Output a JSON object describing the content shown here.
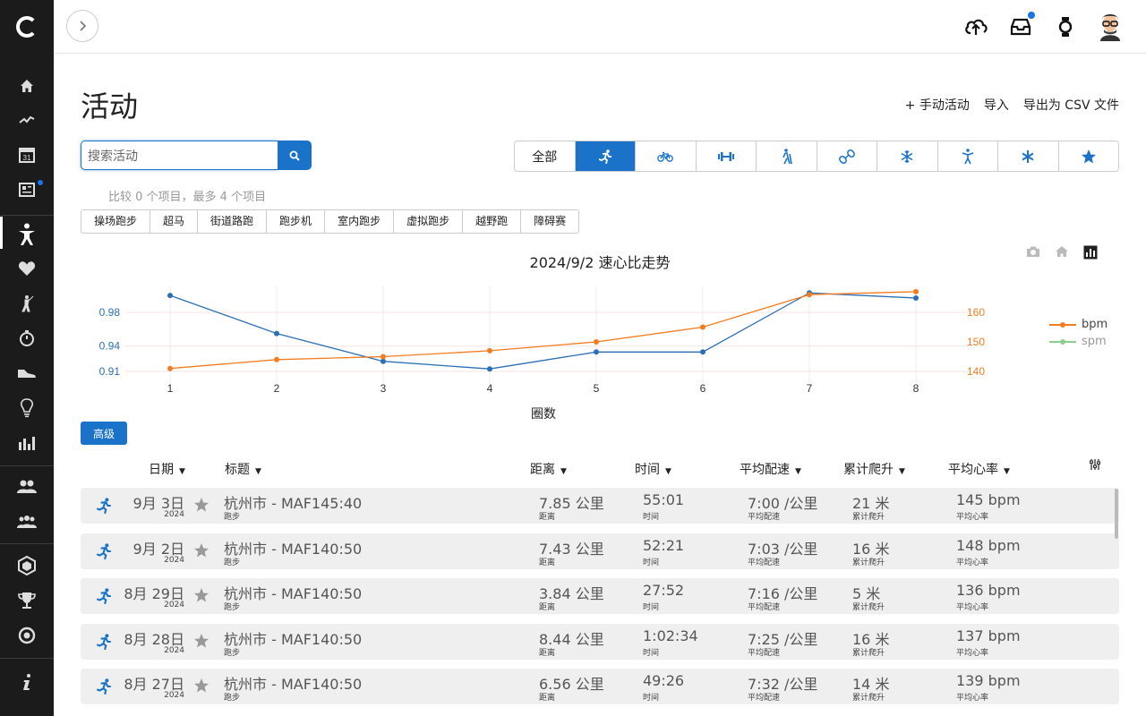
{
  "page": {
    "title": "活动",
    "actions": [
      "+ 手动活动",
      "导入",
      "导出为 CSV 文件"
    ]
  },
  "search": {
    "placeholder": "搜索活动"
  },
  "compare_text": "比较 0 个项目，最多 4 个项目",
  "type_filters": [
    {
      "label": "全部",
      "icon": "",
      "active": false
    },
    {
      "label": "",
      "icon": "running-icon",
      "active": true
    },
    {
      "label": "",
      "icon": "cycling-icon",
      "active": false
    },
    {
      "label": "",
      "icon": "strength-icon",
      "active": false
    },
    {
      "label": "",
      "icon": "hiking-icon",
      "active": false
    },
    {
      "label": "",
      "icon": "multisport-icon",
      "active": false
    },
    {
      "label": "",
      "icon": "winter-sports-icon",
      "active": false
    },
    {
      "label": "",
      "icon": "fitness-icon",
      "active": false
    },
    {
      "label": "",
      "icon": "other-icon",
      "active": false
    },
    {
      "label": "",
      "icon": "favorites-icon",
      "active": false
    }
  ],
  "subtypes": [
    "操场跑步",
    "超马",
    "街道路跑",
    "跑步机",
    "室内跑步",
    "虚拟跑步",
    "越野跑",
    "障碍赛"
  ],
  "chart_data": {
    "type": "line",
    "title": "2024/9/2 速心比走势",
    "xlabel": "圈数",
    "x": [
      1,
      2,
      3,
      4,
      5,
      6,
      7,
      8
    ],
    "y_left_ticks": [
      "0.91",
      "0.94",
      "0.98"
    ],
    "y_right_ticks": [
      "140",
      "150",
      "160"
    ],
    "series": [
      {
        "name": "",
        "axis": "left",
        "color": "#2b6fb5",
        "values": [
          1.0,
          0.955,
          0.922,
          0.913,
          0.933,
          0.933,
          1.003,
          0.997
        ]
      },
      {
        "name": "bpm",
        "axis": "right",
        "color": "#f47c20",
        "values": [
          141,
          144,
          145,
          147,
          150,
          155,
          166,
          167
        ]
      },
      {
        "name": "spm",
        "axis": "right",
        "color": "#8ccf8c",
        "values": []
      }
    ],
    "legend_placement": "right",
    "grid": true
  },
  "advanced_button": "高级",
  "table": {
    "headers": [
      "日期",
      "标题",
      "距离",
      "时间",
      "平均配速",
      "累计爬升",
      "平均心率"
    ],
    "sub_labels": {
      "distance": "距离",
      "time": "时间",
      "pace": "平均配速",
      "ascent": "累计爬升",
      "hr": "平均心率"
    },
    "rows": [
      {
        "date": "9月 3日",
        "year": "2024",
        "title": "杭州市 - MAF145:40",
        "type": "跑步",
        "distance": "7.85 公里",
        "time": "55:01",
        "pace": "7:00 /公里",
        "ascent": "21 米",
        "hr": "145 bpm"
      },
      {
        "date": "9月 2日",
        "year": "2024",
        "title": "杭州市 - MAF140:50",
        "type": "跑步",
        "distance": "7.43 公里",
        "time": "52:21",
        "pace": "7:03 /公里",
        "ascent": "16 米",
        "hr": "148 bpm"
      },
      {
        "date": "8月 29日",
        "year": "2024",
        "title": "杭州市 - MAF140:50",
        "type": "跑步",
        "distance": "3.84 公里",
        "time": "27:52",
        "pace": "7:16 /公里",
        "ascent": "5 米",
        "hr": "136 bpm"
      },
      {
        "date": "8月 28日",
        "year": "2024",
        "title": "杭州市 - MAF140:50",
        "type": "跑步",
        "distance": "8.44 公里",
        "time": "1:02:34",
        "pace": "7:25 /公里",
        "ascent": "16 米",
        "hr": "137 bpm"
      },
      {
        "date": "8月 27日",
        "year": "2024",
        "title": "杭州市 - MAF140:50",
        "type": "跑步",
        "distance": "6.56 公里",
        "time": "49:26",
        "pace": "7:32 /公里",
        "ascent": "14 米",
        "hr": "139 bpm"
      }
    ]
  },
  "colors": {
    "accent": "#1a73c8",
    "sidebar": "#1b1b1b",
    "bpm": "#f47c20",
    "ratio": "#2b6fb5"
  }
}
